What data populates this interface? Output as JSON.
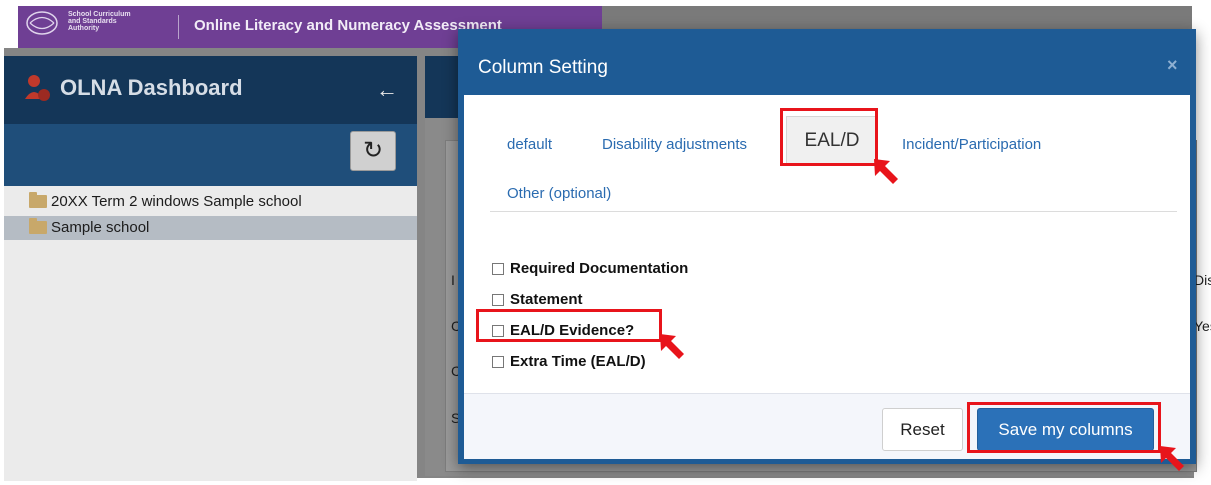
{
  "app": {
    "logo_text": "School Curriculum\nand Standards\nAuthority",
    "topbar_title": "Online Literacy and Numeracy Assessment"
  },
  "sidebar": {
    "title": "OLNA Dashboard",
    "tree": [
      {
        "label": "20XX Term 2 windows Sample school"
      },
      {
        "label": "Sample school"
      }
    ]
  },
  "background_fragments": {
    "col_fragment": "Dis",
    "cell_fragment": "Yes",
    "row_letters": [
      "I",
      "C",
      "C",
      "C",
      "S"
    ]
  },
  "modal": {
    "title": "Column Setting",
    "close": "×",
    "tabs": [
      {
        "label": "default"
      },
      {
        "label": "Disability adjustments"
      },
      {
        "label": "EAL/D",
        "active": true
      },
      {
        "label": "Incident/Participation"
      },
      {
        "label": "Other (optional)"
      }
    ],
    "options": [
      {
        "label": "Required Documentation",
        "checked": false
      },
      {
        "label": "Statement",
        "checked": false
      },
      {
        "label": "EAL/D Evidence?",
        "checked": false
      },
      {
        "label": "Extra Time (EAL/D)",
        "checked": false
      }
    ],
    "reset_label": "Reset",
    "save_label": "Save my columns"
  },
  "colors": {
    "modal_header": "#1e5b95",
    "annotation": "#e8141b",
    "save_button": "#2b71b8",
    "topbar": "#6f3f94"
  },
  "icons": [
    "crest-logo-icon",
    "olna-logo-icon",
    "arrow-left-icon",
    "refresh-icon",
    "folder-icon",
    "close-icon",
    "checkbox-icon",
    "annotation-arrow-icon"
  ]
}
